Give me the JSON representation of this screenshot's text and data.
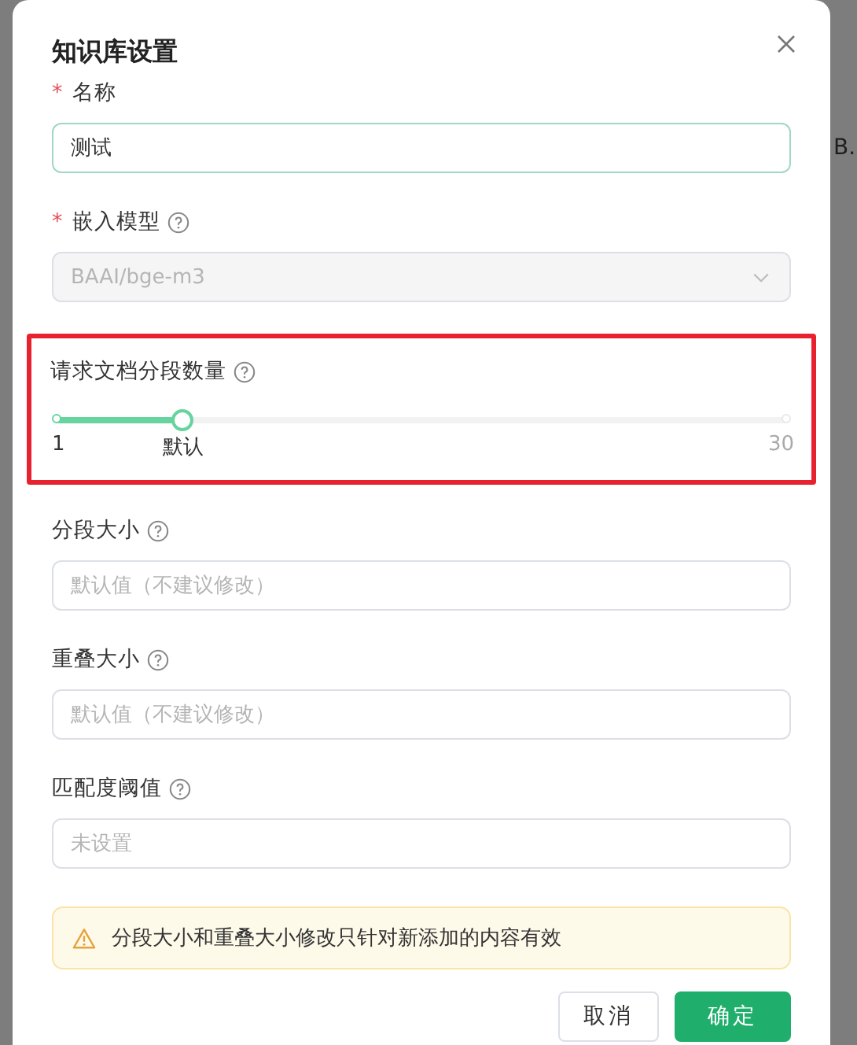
{
  "backdrop": {
    "text": "B."
  },
  "dialog": {
    "title": "知识库设置",
    "fields": [
      {
        "kind": "text",
        "required_mark": "*",
        "label": "名称",
        "help": false,
        "value": "测试",
        "focused": true
      },
      {
        "kind": "select",
        "required_mark": "*",
        "label": "嵌入模型",
        "help": true,
        "value": "BAAI/bge-m3",
        "disabled": true
      },
      {
        "kind": "slider",
        "label": "请求文档分段数量",
        "help": true,
        "highlighted": true,
        "level": 0.173,
        "min_label": "1",
        "handle_label": "默认",
        "max_label": "30"
      },
      {
        "kind": "text",
        "label": "分段大小",
        "help": true,
        "placeholder": "默认值（不建议修改）"
      },
      {
        "kind": "text",
        "label": "重叠大小",
        "help": true,
        "placeholder": "默认值（不建议修改）"
      },
      {
        "kind": "text",
        "label": "匹配度阈值",
        "help": true,
        "placeholder": "未设置"
      }
    ],
    "alert": {
      "text": "分段大小和重叠大小修改只针对新添加的内容有效"
    },
    "buttons": [
      {
        "label": "取消",
        "primary": false
      },
      {
        "label": "确定",
        "primary": true
      }
    ]
  }
}
